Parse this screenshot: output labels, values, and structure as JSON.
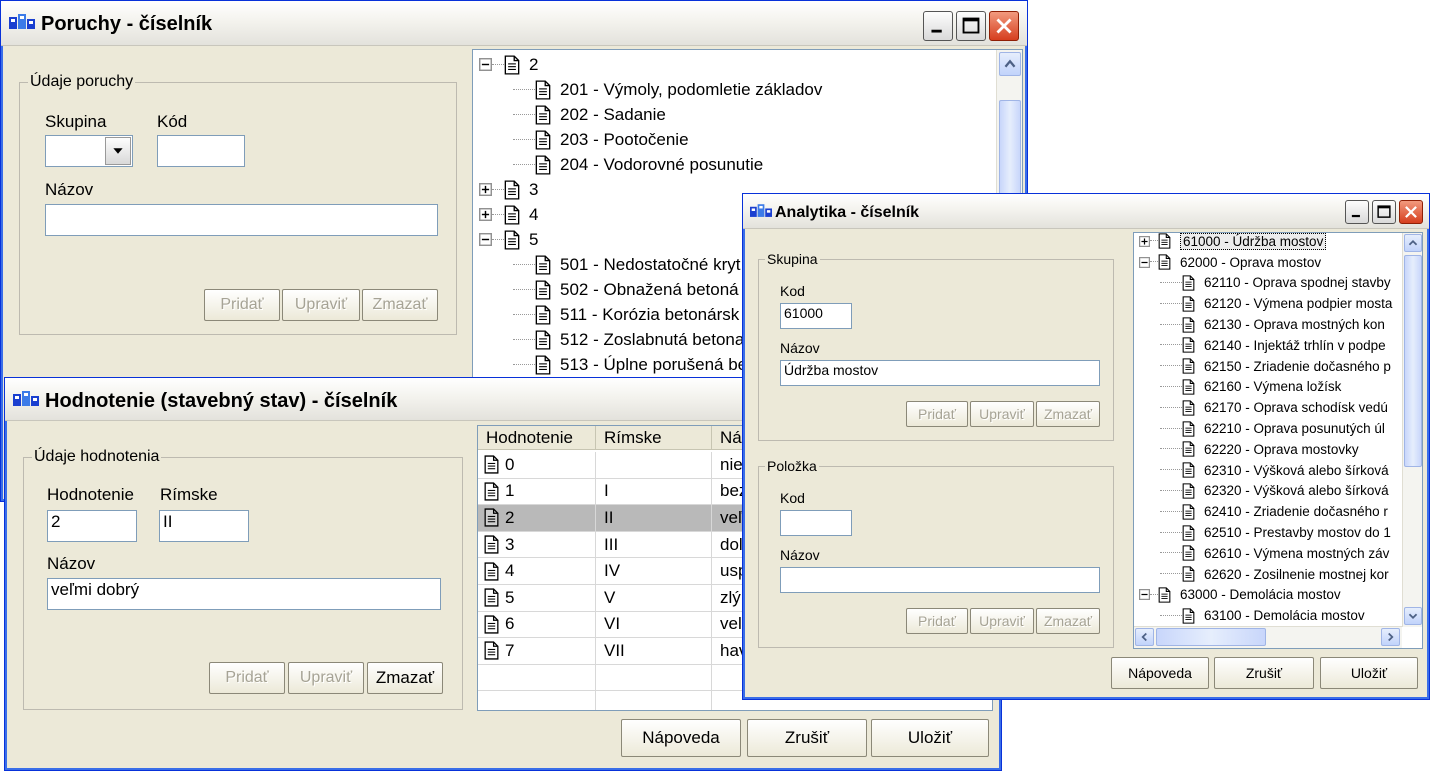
{
  "colors": {
    "title_bg": "#f4f3ee",
    "window_bg": "#ece9d8",
    "selection": "#b9b9b9",
    "field_border": "#7f9db9"
  },
  "poruchy": {
    "title": "Poruchy - číselník",
    "fieldset_legend": "Údaje poruchy",
    "skupina_label": "Skupina",
    "kod_label": "Kód",
    "nazov_label": "Názov",
    "skupina_value": "",
    "kod_value": "",
    "nazov_value": "",
    "buttons": {
      "add": "Pridať",
      "edit": "Upraviť",
      "delete": "Zmazať"
    },
    "tree": [
      {
        "text": "2",
        "level": 0,
        "expander": "minus"
      },
      {
        "text": "201 - Výmoly, podomletie základov",
        "level": 1
      },
      {
        "text": "202 - Sadanie",
        "level": 1
      },
      {
        "text": "203 - Pootočenie",
        "level": 1
      },
      {
        "text": "204 - Vodorovné posunutie",
        "level": 1
      },
      {
        "text": "3",
        "level": 0,
        "expander": "plus"
      },
      {
        "text": "4",
        "level": 0,
        "expander": "plus"
      },
      {
        "text": "5",
        "level": 0,
        "expander": "minus"
      },
      {
        "text": "501 - Nedostatočné kryt",
        "level": 1
      },
      {
        "text": "502 - Obnažená betoná",
        "level": 1
      },
      {
        "text": "511 - Korózia betonársk",
        "level": 1
      },
      {
        "text": "512 - Zoslabnutá betona",
        "level": 1
      },
      {
        "text": "513 - Úplne porušená be",
        "level": 1
      }
    ]
  },
  "hodnotenie": {
    "title": "Hodnotenie (stavebný stav) - číselník",
    "fieldset_legend": "Údaje hodnotenia",
    "hodnotenie_label": "Hodnotenie",
    "rimske_label": "Rímske",
    "nazov_label": "Názov",
    "hodnotenie_value": "2",
    "rimske_value": "II",
    "nazov_value": "veľmi dobrý",
    "buttons": {
      "add": "Pridať",
      "edit": "Upraviť",
      "delete": "Zmazať"
    },
    "columns": [
      "Hodnotenie",
      "Rímske",
      "Ná"
    ],
    "rows": [
      {
        "hodnotenie": "0",
        "rimske": "",
        "nazov": "nie"
      },
      {
        "hodnotenie": "1",
        "rimske": "I",
        "nazov": "bez"
      },
      {
        "hodnotenie": "2",
        "rimske": "II",
        "nazov": "veľ"
      },
      {
        "hodnotenie": "3",
        "rimske": "III",
        "nazov": "dol"
      },
      {
        "hodnotenie": "4",
        "rimske": "IV",
        "nazov": "usp"
      },
      {
        "hodnotenie": "5",
        "rimske": "V",
        "nazov": "zlý"
      },
      {
        "hodnotenie": "6",
        "rimske": "VI",
        "nazov": "vel"
      },
      {
        "hodnotenie": "7",
        "rimske": "VII",
        "nazov": "hav"
      }
    ],
    "selected_row": 2,
    "footer": {
      "help": "Nápoveda",
      "cancel": "Zrušiť",
      "save": "Uložiť"
    }
  },
  "analytika": {
    "title": "Analytika - číselník",
    "skupina_legend": "Skupina",
    "polozka_legend": "Položka",
    "kod_label": "Kod",
    "nazov_label": "Názov",
    "skupina_kod_value": "61000",
    "skupina_nazov_value": "Údržba mostov",
    "polozka_kod_value": "",
    "polozka_nazov_value": "",
    "buttons": {
      "add": "Pridať",
      "edit": "Upraviť",
      "delete": "Zmazať"
    },
    "tree": [
      {
        "text": "61000 - Údržba mostov",
        "level": 0,
        "expander": "plus",
        "selected": true
      },
      {
        "text": "62000 - Oprava mostov",
        "level": 0,
        "expander": "minus"
      },
      {
        "text": "62110 - Oprava spodnej stavby",
        "level": 1
      },
      {
        "text": "62120 - Výmena podpier mosta",
        "level": 1
      },
      {
        "text": "62130 - Oprava mostných kon",
        "level": 1
      },
      {
        "text": "62140 - Injektáž trhlín v podpe",
        "level": 1
      },
      {
        "text": "62150 - Zriadenie dočasného p",
        "level": 1
      },
      {
        "text": "62160 - Výmena ložísk",
        "level": 1
      },
      {
        "text": "62170 - Oprava schodísk vedú",
        "level": 1
      },
      {
        "text": "62210 - Oprava posunutých úl",
        "level": 1
      },
      {
        "text": "62220 - Oprava mostovky",
        "level": 1
      },
      {
        "text": "62310 - Výšková alebo šírková",
        "level": 1
      },
      {
        "text": "62320 - Výšková alebo šírková",
        "level": 1
      },
      {
        "text": "62410 - Zriadenie dočasného r",
        "level": 1
      },
      {
        "text": "62510 - Prestavby mostov do 1",
        "level": 1
      },
      {
        "text": "62610 - Výmena mostných záv",
        "level": 1
      },
      {
        "text": "62620 - Zosilnenie mostnej kor",
        "level": 1
      },
      {
        "text": "63000 - Demolácia mostov",
        "level": 0,
        "expander": "minus"
      },
      {
        "text": "63100 - Demolácia mostov",
        "level": 1
      }
    ],
    "footer": {
      "help": "Nápoveda",
      "cancel": "Zrušiť",
      "save": "Uložiť"
    }
  }
}
